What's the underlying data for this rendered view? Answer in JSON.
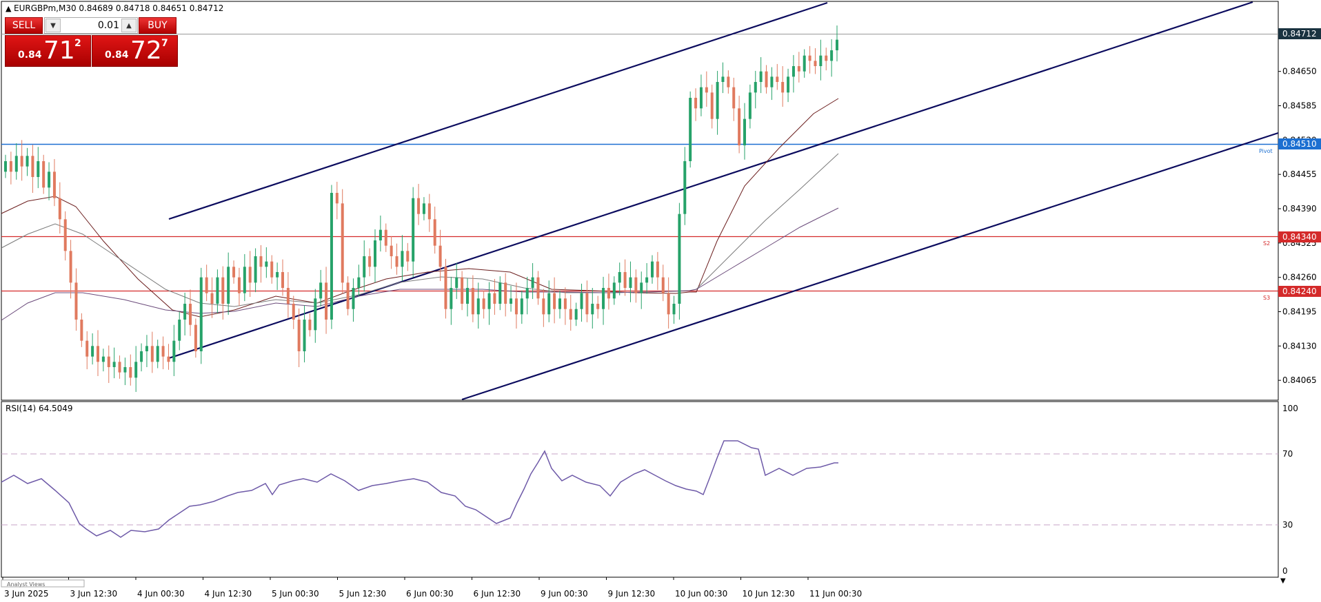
{
  "chart": {
    "header": "EURGBPm,M30  0.84689 0.84718 0.84651 0.84712",
    "pivot_label": "Pivot",
    "s2_label": "S2",
    "s3_label": "S3",
    "current_price_label": "0.84712",
    "footer_label": "Analyst Views"
  },
  "trade_panel": {
    "sell_label": "SELL",
    "buy_label": "BUY",
    "lot_value": "0.01",
    "sell_price": {
      "prefix": "0.84",
      "big": "71",
      "sup": "2"
    },
    "buy_price": {
      "prefix": "0.84",
      "big": "72",
      "sup": "7"
    }
  },
  "rsi": {
    "label": "RSI(14) 64.5049"
  },
  "colors": {
    "bull": "#26a269",
    "bear": "#e07a5f",
    "channel": "#0b0b5e",
    "pivot": "#1c6fd1",
    "support": "#d42a2a",
    "rsi": "#6e5aa8"
  },
  "chart_data": {
    "type": "candlestick",
    "price_axis": {
      "ylim": [
        0.8403,
        0.8478
      ],
      "ticks": [
        "0.84650",
        "0.84585",
        "0.84520",
        "0.84455",
        "0.84390",
        "0.84325",
        "0.84260",
        "0.84195",
        "0.84130",
        "0.84065"
      ]
    },
    "time_labels": [
      "3 Jun 2025",
      "3 Jun 12:30",
      "4 Jun 00:30",
      "4 Jun 12:30",
      "5 Jun 00:30",
      "5 Jun 12:30",
      "6 Jun 00:30",
      "6 Jun 12:30",
      "9 Jun 00:30",
      "9 Jun 12:30",
      "10 Jun 00:30",
      "10 Jun 12:30",
      "11 Jun 00:30"
    ],
    "levels": [
      {
        "name": "Pivot",
        "value": 0.8451,
        "label": "0.84510"
      },
      {
        "name": "S2",
        "value": 0.8434,
        "label": "0.84340"
      },
      {
        "name": "S3",
        "value": 0.8424,
        "label": "0.84240"
      }
    ],
    "current_price": 0.84712,
    "closes": [
      0.8448,
      0.8446,
      0.8449,
      0.8447,
      0.8449,
      0.8445,
      0.8448,
      0.8443,
      0.8446,
      0.8441,
      0.8437,
      0.8431,
      0.8425,
      0.8418,
      0.8414,
      0.8411,
      0.8413,
      0.841,
      0.8411,
      0.8409,
      0.841,
      0.8408,
      0.8409,
      0.8407,
      0.841,
      0.8412,
      0.8413,
      0.841,
      0.8413,
      0.8411,
      0.841,
      0.8414,
      0.8418,
      0.8421,
      0.8417,
      0.8412,
      0.8426,
      0.8423,
      0.8421,
      0.8426,
      0.8421,
      0.8428,
      0.8426,
      0.8423,
      0.8428,
      0.8425,
      0.843,
      0.8428,
      0.8429,
      0.8426,
      0.8427,
      0.8424,
      0.8421,
      0.8418,
      0.8412,
      0.8418,
      0.8416,
      0.8422,
      0.8425,
      0.8418,
      0.8442,
      0.844,
      0.8425,
      0.842,
      0.8424,
      0.8426,
      0.843,
      0.8428,
      0.8433,
      0.8435,
      0.8432,
      0.843,
      0.8428,
      0.8431,
      0.8429,
      0.8441,
      0.8438,
      0.844,
      0.8437,
      0.8432,
      0.8428,
      0.842,
      0.8424,
      0.8426,
      0.8421,
      0.8424,
      0.8419,
      0.8422,
      0.842,
      0.8423,
      0.8421,
      0.8425,
      0.8421,
      0.8422,
      0.8419,
      0.8422,
      0.8424,
      0.8426,
      0.8422,
      0.8419,
      0.8423,
      0.842,
      0.8422,
      0.842,
      0.8418,
      0.842,
      0.8423,
      0.8419,
      0.8421,
      0.842,
      0.8424,
      0.8422,
      0.8425,
      0.8427,
      0.8424,
      0.8426,
      0.8423,
      0.8425,
      0.8426,
      0.8429,
      0.8426,
      0.8423,
      0.8419,
      0.8421,
      0.8438,
      0.8448,
      0.846,
      0.8458,
      0.8462,
      0.8461,
      0.8456,
      0.8463,
      0.8464,
      0.8462,
      0.8458,
      0.8451,
      0.8456,
      0.8461,
      0.8463,
      0.8465,
      0.8462,
      0.8464,
      0.8463,
      0.8461,
      0.8464,
      0.8466,
      0.8465,
      0.8468,
      0.8467,
      0.8466,
      0.8468,
      0.8467,
      0.8469,
      0.8471
    ]
  }
}
